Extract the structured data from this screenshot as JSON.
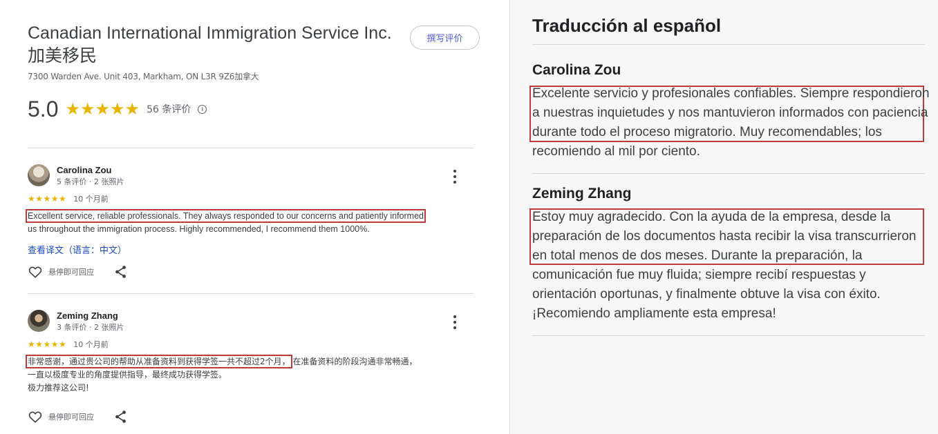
{
  "business": {
    "name": "Canadian International Immigration Service Inc. 加美移民",
    "address": "7300 Warden Ave. Unit 403, Markham, ON L3R 9Z6加拿大",
    "rating": "5.0",
    "stars": "★★★★★",
    "review_count": "56 条评价",
    "info_glyph": "i",
    "write_review_label": "撰写评价"
  },
  "reviews": [
    {
      "name": "Carolina Zou",
      "meta": "5 条评价 · 2 张照片",
      "stars": "★★★★★",
      "time": "10 个月前",
      "text_highlight": "Excellent service, reliable professionals. They always responded to our concerns and patiently informed",
      "text_rest": "us throughout the immigration process. Highly recommended, I recommend them 1000%.",
      "translate_link": "查看译文（语言：中文）",
      "like_label": "悬停即可回应"
    },
    {
      "name": "Zeming Zhang",
      "meta": "3 条评价 · 2 张照片",
      "stars": "★★★★★",
      "time": "10 个月前",
      "text_highlight": "非常感谢，通过贵公司的帮助从准备资料到获得学签一共不超过2个月，",
      "text_rest": "在准备资料的阶段沟通非常畅通，",
      "text_line2": "一直以极度专业的角度提供指导，最终成功获得学签。",
      "text_line3": "极力推荐这公司!",
      "like_label": "悬停即可回应"
    }
  ],
  "translation": {
    "title": "Traducción al español",
    "entries": [
      {
        "name": "Carolina Zou",
        "text_highlight": "Excelente servicio y profesionales confiables. Siempre respondieron a nuestras inquietudes y nos mantuvieron informados con paciencia durante todo el proceso migratorio.",
        "text_rest": "Muy recomendables; los recomiendo al mil por ciento."
      },
      {
        "name": "Zeming Zhang",
        "text_highlight": "Estoy muy agradecido. Con la ayuda de la empresa, desde la preparación de los documentos hasta recibir la visa transcurrieron en total menos de dos meses.",
        "text_rest": "Durante la preparación, la comunicación fue muy fluida; siempre recibí respuestas y orientación oportunas, y finalmente obtuve la visa con éxito. ¡Recomiendo ampliamente esta empresa!"
      }
    ]
  },
  "colors": {
    "star": "#e7b400",
    "highlight_box": "#c0393b",
    "link": "#1a4ac2"
  },
  "icons": [
    "info-icon",
    "more-vert-icon",
    "heart-icon",
    "share-icon"
  ]
}
